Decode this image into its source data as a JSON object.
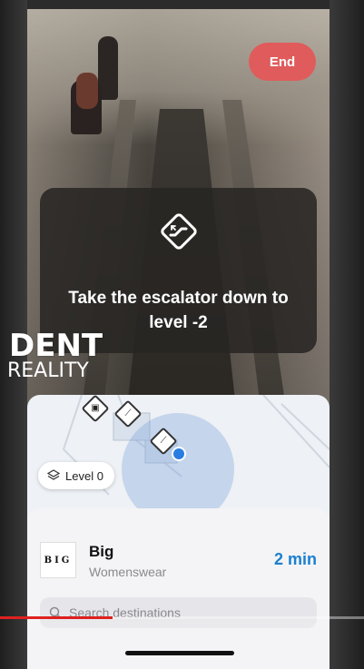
{
  "navigation": {
    "end_label": "End",
    "instruction": "Take the escalator down to level -2",
    "instruction_icon": "escalator-icon"
  },
  "watermark": {
    "line1": "DENT",
    "line2": "REALITY"
  },
  "map": {
    "level_label": "Level 0",
    "level_icon": "layers-icon"
  },
  "destination": {
    "logo_text": "BIG",
    "name": "Big",
    "category": "Womenswear",
    "eta": "2 min"
  },
  "search": {
    "placeholder": "Search destinations"
  },
  "video": {
    "progress_fraction": 0.31
  },
  "colors": {
    "end_button": "#e05b5b",
    "eta": "#1b7fd0",
    "progress": "#e02020"
  }
}
